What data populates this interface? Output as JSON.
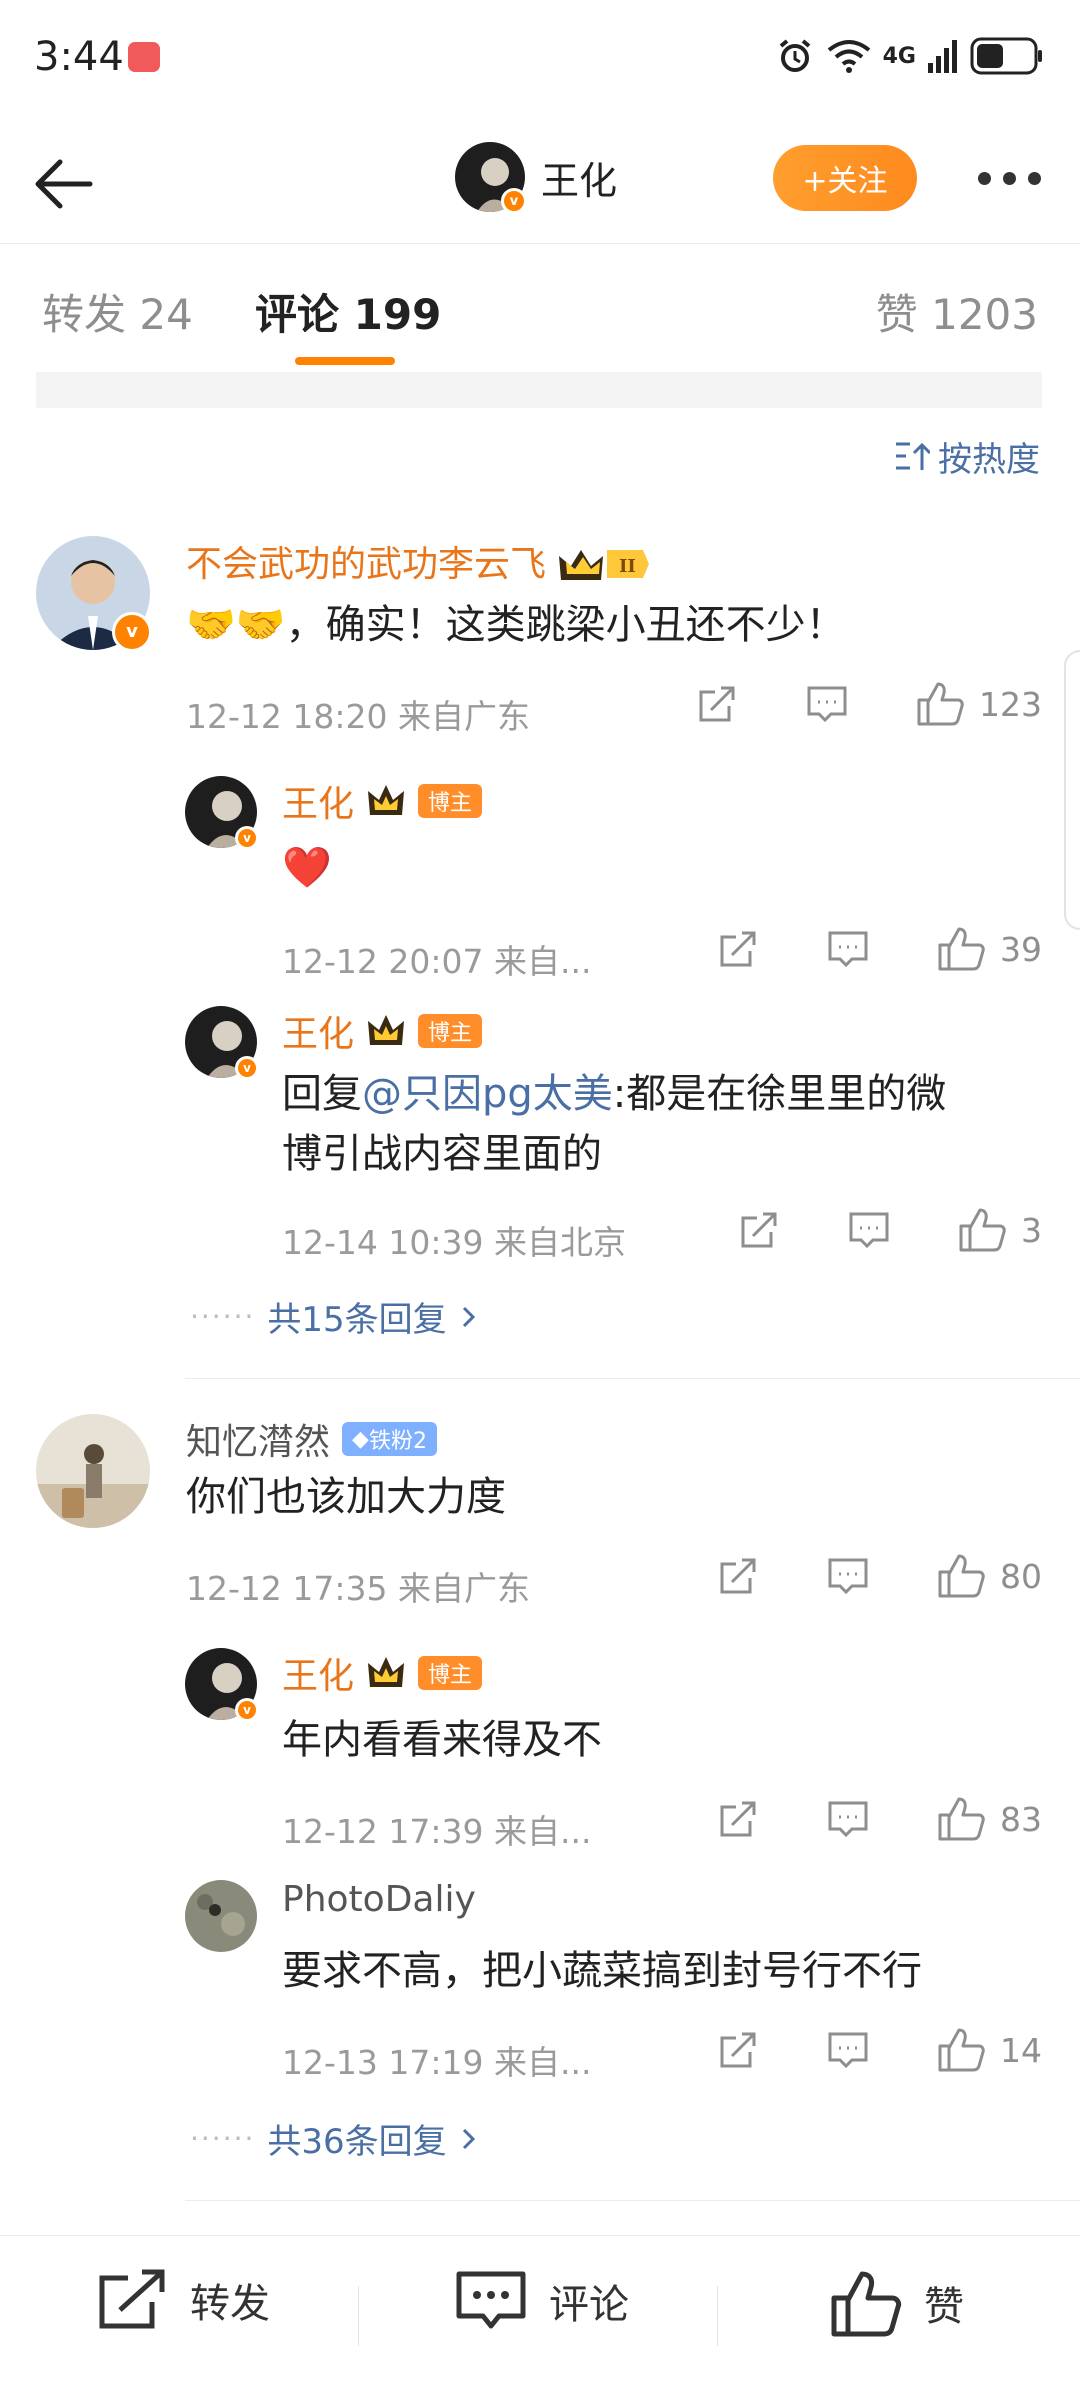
{
  "status_bar": {
    "time": "3:44",
    "network": "4G"
  },
  "header": {
    "username": "王化",
    "follow_label": "+关注"
  },
  "tabs": {
    "repost": "转发 24",
    "comments": "评论 199",
    "likes": "赞 1203"
  },
  "sort_label": "按热度",
  "comments": [
    {
      "name": "不会武功的武功李云飞",
      "text": "🤝🤝，确实！这类跳梁小丑还不少！",
      "meta": "12-12 18:20  来自广东",
      "likes": "123",
      "replies": [
        {
          "name": "王化",
          "tag": "博主",
          "text": "❤️",
          "meta": "12-12 20:07  来自...",
          "likes": "39"
        },
        {
          "name": "王化",
          "tag": "博主",
          "reply_prefix": "回复",
          "mention": "@只因pg太美",
          "text": ":都是在徐里里的微",
          "text2": "博引战内容里面的",
          "meta": "12-14 10:39  来自北京",
          "likes": "3"
        }
      ],
      "more_replies": "共15条回复"
    },
    {
      "name": "知忆潸然",
      "tag": "铁粉2",
      "text": "你们也该加大力度",
      "meta": "12-12 17:35  来自广东",
      "likes": "80",
      "replies": [
        {
          "name": "王化",
          "tag": "博主",
          "text": "年内看看来得及不",
          "meta": "12-12 17:39  来自...",
          "likes": "83"
        },
        {
          "name": "PhotoDaliy",
          "text": "要求不高，把小蔬菜搞到封号行不行",
          "meta": "12-13 17:19  来自...",
          "likes": "14"
        }
      ],
      "more_replies": "共36条回复"
    }
  ],
  "bottom_bar": {
    "repost": "转发",
    "comment": "评论",
    "like": "赞"
  },
  "colors": {
    "accent": "#ff8200",
    "link": "#4a6fa5"
  }
}
